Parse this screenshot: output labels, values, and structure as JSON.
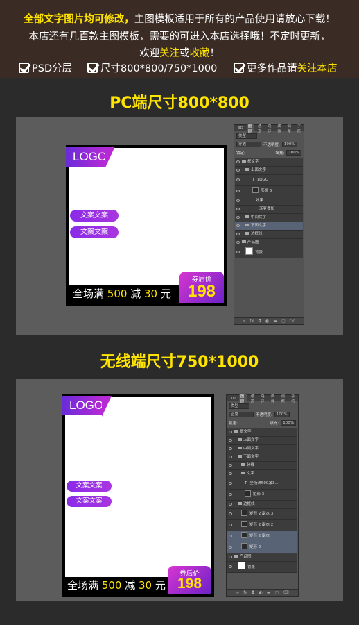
{
  "banner": {
    "line1_bold": "全部文字图片均可修改，",
    "line1_rest": "主图模板适用于所有的产品使用请放心下载！",
    "line2": "本店还有几百款主图模板，需要的可进入本店选择哦！不定时更新，",
    "line3_pre": "欢迎",
    "line3_follow": "关注",
    "line3_or": "或",
    "line3_fav": "收藏",
    "line3_end": "！",
    "checks": [
      {
        "label": "PSD分层"
      },
      {
        "label": "尺寸800*800/750*1000"
      },
      {
        "label": "更多作品请",
        "accent": "关注本店"
      }
    ]
  },
  "section1": {
    "title": "PC端尺寸800*800",
    "template": {
      "logo": "LOGO",
      "pills": [
        "文案文案",
        "文案文案"
      ],
      "price_pre": "全场满",
      "price_a": "500",
      "price_mid": "减",
      "price_b": "30",
      "price_unit": "元",
      "coupon_label": "券后价",
      "coupon_value": "198"
    },
    "ps": {
      "tabs": [
        "3D",
        "图层",
        "通道",
        "路径",
        "属性",
        "调整",
        "字符"
      ],
      "filter": "类型",
      "blend": "穿透",
      "opacity_label": "不透明度:",
      "opacity": "100%",
      "lock_label": "锁定:",
      "fill_label": "填充:",
      "fill": "100%",
      "layers": [
        {
          "name": "框文字",
          "indent": 0,
          "folder": true
        },
        {
          "name": "上面文字",
          "indent": 1,
          "folder": true
        },
        {
          "name": "LOGO",
          "indent": 3,
          "type": "T",
          "tall": true
        },
        {
          "name": "形状 6",
          "indent": 3,
          "thumb": true,
          "tall": true
        },
        {
          "name": "效果",
          "indent": 4
        },
        {
          "name": "渐变叠加",
          "indent": 5
        },
        {
          "name": "中间文字",
          "indent": 1,
          "folder": true
        },
        {
          "name": "下面文字",
          "indent": 1,
          "folder": true,
          "hl": true
        },
        {
          "name": "边框线",
          "indent": 1,
          "folder": true
        },
        {
          "name": "产品图",
          "indent": 0,
          "folder": true
        },
        {
          "name": "背景",
          "indent": 1,
          "white": true,
          "tall": true
        }
      ]
    }
  },
  "section2": {
    "title": "无线端尺寸750*1000",
    "template": {
      "logo": "LOGO",
      "pills": [
        "文案文案",
        "文案文案"
      ],
      "price_pre": "全场满",
      "price_a": "500",
      "price_mid": "减",
      "price_b": "30",
      "price_unit": "元",
      "coupon_label": "券后价",
      "coupon_value": "198"
    },
    "ps": {
      "tabs": [
        "3D",
        "图层",
        "通道",
        "路径",
        "属性",
        "调整",
        "字符"
      ],
      "filter": "类型",
      "blend": "正常",
      "opacity_label": "不透明度:",
      "opacity": "100%",
      "lock_label": "锁定:",
      "fill_label": "填充:",
      "fill": "100%",
      "layers": [
        {
          "name": "框文字",
          "indent": 0,
          "folder": true
        },
        {
          "name": "上面文字",
          "indent": 1,
          "folder": true
        },
        {
          "name": "中间文字",
          "indent": 1,
          "folder": true
        },
        {
          "name": "下面文字",
          "indent": 1,
          "folder": true
        },
        {
          "name": "分线",
          "indent": 2,
          "folder": true
        },
        {
          "name": "文字",
          "indent": 2,
          "folder": true
        },
        {
          "name": "全场满500减3...",
          "indent": 3,
          "type": "T",
          "tall": true
        },
        {
          "name": "矩形 3",
          "indent": 3,
          "thumb": true,
          "tall": true
        },
        {
          "name": "边框线",
          "indent": 1,
          "folder": true
        },
        {
          "name": "矩形 2 副本 3",
          "indent": 2,
          "thumb": true,
          "tall": true
        },
        {
          "name": "矩形 2 副本 2",
          "indent": 2,
          "thumb": true,
          "tall": true
        },
        {
          "name": "矩形 2 副本",
          "indent": 2,
          "thumb": true,
          "tall": true,
          "hl": true
        },
        {
          "name": "矩形 2",
          "indent": 2,
          "thumb": true,
          "tall": true,
          "hl": true
        },
        {
          "name": "产品图",
          "indent": 0,
          "folder": true
        },
        {
          "name": "背景",
          "indent": 1,
          "white": true,
          "tall": true
        }
      ]
    }
  }
}
